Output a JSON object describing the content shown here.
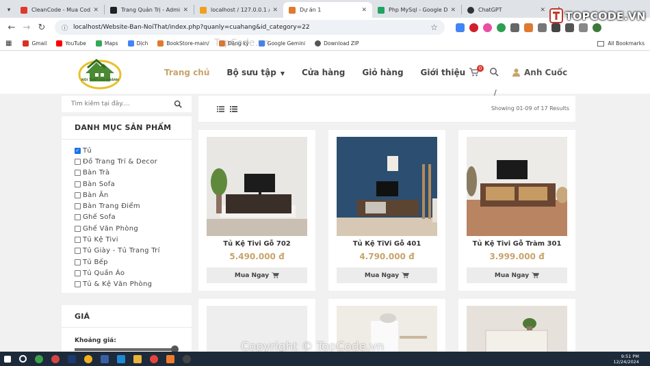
{
  "browser": {
    "tabs": [
      {
        "title": "CleanCode - Mua Code trực",
        "color": "#e0392b",
        "active": false
      },
      {
        "title": "Trang Quản Trị - Admin",
        "color": "#222222",
        "active": false
      },
      {
        "title": "localhost / 127.0.0.1 / lid / u",
        "color": "#f0a020",
        "active": false
      },
      {
        "title": "Dự án 1",
        "color": "#e07a30",
        "active": true
      },
      {
        "title": "Php MySql - Google Drive",
        "color": "#1fa463",
        "active": false
      },
      {
        "title": "ChatGPT",
        "color": "#333333",
        "active": false
      }
    ],
    "url": "localhost/Website-Ban-NoiThat/index.php?quanly=cuahang&id_category=22",
    "bookmarks": [
      {
        "label": "Gmail",
        "color": "#d93025"
      },
      {
        "label": "YouTube",
        "color": "#ff0000"
      },
      {
        "label": "Maps",
        "color": "#34a853"
      },
      {
        "label": "Dịch",
        "color": "#4285f4"
      },
      {
        "label": "BookStore-main/",
        "color": "#e07a30"
      },
      {
        "label": "Đăng ký",
        "color": "#e07a30"
      },
      {
        "label": "Google Gemini",
        "color": "#4285f4"
      },
      {
        "label": "Download ZIP",
        "color": "#555555"
      }
    ],
    "all_bookmarks": "All Bookmarks"
  },
  "header": {
    "logo_text": "NỘI THẤT GIA KHÁNH",
    "nav": [
      "Trang chủ",
      "Bộ sưu tập",
      "Cửa hàng",
      "Giỏ hàng",
      "Giới thiệu"
    ],
    "cart_count": "0",
    "user": "Anh Cuốc",
    "accent": "#c8a36a"
  },
  "sidebar": {
    "search_placeholder": "Tìm kiếm tại đây....",
    "categories_title": "DANH MỤC SẢN PHẨM",
    "categories": [
      {
        "label": "Tủ",
        "checked": true
      },
      {
        "label": "Đồ Trang Trí & Decor",
        "checked": false
      },
      {
        "label": "Bàn Trà",
        "checked": false
      },
      {
        "label": "Bàn Sofa",
        "checked": false
      },
      {
        "label": "Bàn Ăn",
        "checked": false
      },
      {
        "label": "Bàn Trang Điểm",
        "checked": false
      },
      {
        "label": "Ghế Sofa",
        "checked": false
      },
      {
        "label": "Ghế Văn Phòng",
        "checked": false
      },
      {
        "label": "Tủ Kệ Tivi",
        "checked": false
      },
      {
        "label": "Tủ Giày - Tủ Trang Trí",
        "checked": false
      },
      {
        "label": "Tủ Bếp",
        "checked": false
      },
      {
        "label": "Tủ Quần Áo",
        "checked": false
      },
      {
        "label": "Tủ & Kệ Văn Phòng",
        "checked": false
      }
    ],
    "price_title": "GIÁ",
    "price_label": "Khoảng giá:"
  },
  "toolbar": {
    "results": "Showing 01-09 of 17 Results"
  },
  "products": [
    {
      "name": "Tủ Kệ Tivi Gỗ 702",
      "price": "5.490.000 đ",
      "buy": "Mua Ngay"
    },
    {
      "name": "Tủ Kệ TiVi Gỗ 401",
      "price": "4.790.000 đ",
      "buy": "Mua Ngay"
    },
    {
      "name": "Tủ Kệ Tivi Gỗ Tràm 301",
      "price": "3.999.000 đ",
      "buy": "Mua Ngay"
    }
  ],
  "taskbar": {
    "time": "9:51 PM",
    "date": "12/24/2024"
  },
  "watermark": {
    "logo": "TOPCODE.VN",
    "bottom": "Copyright © TopCode.vn",
    "middle": "TopCode.vn"
  }
}
